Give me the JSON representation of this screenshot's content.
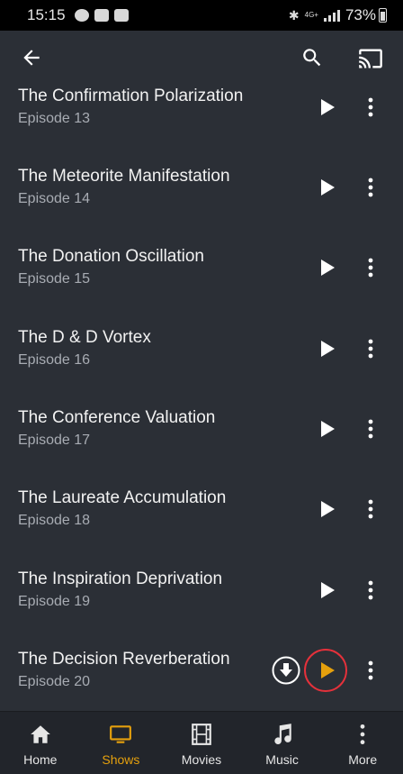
{
  "status_bar": {
    "time": "15:15",
    "network_label": "4G+",
    "battery_percent": "73%"
  },
  "app_bar": {
    "back_icon": "back-arrow-icon",
    "search_icon": "search-icon",
    "cast_icon": "cast-icon"
  },
  "episodes": [
    {
      "title": "The Confirmation Polarization",
      "subtitle": "Episode 13"
    },
    {
      "title": "The Meteorite Manifestation",
      "subtitle": "Episode 14"
    },
    {
      "title": "The Donation Oscillation",
      "subtitle": "Episode 15"
    },
    {
      "title": "The D & D Vortex",
      "subtitle": "Episode 16"
    },
    {
      "title": "The Conference Valuation",
      "subtitle": "Episode 17"
    },
    {
      "title": "The Laureate Accumulation",
      "subtitle": "Episode 18"
    },
    {
      "title": "The Inspiration Deprivation",
      "subtitle": "Episode 19"
    },
    {
      "title": "The Decision Reverberation",
      "subtitle": "Episode 20"
    }
  ],
  "bottom_nav": [
    {
      "label": "Home",
      "icon": "home-icon"
    },
    {
      "label": "Shows",
      "icon": "tv-icon",
      "active": true
    },
    {
      "label": "Movies",
      "icon": "film-icon"
    },
    {
      "label": "Music",
      "icon": "music-note-icon"
    },
    {
      "label": "More",
      "icon": "more-vertical-icon"
    }
  ],
  "colors": {
    "background": "#2b2f36",
    "accent": "#e5a00d",
    "highlight_ring": "#e5313b",
    "nav_background": "#22252b"
  }
}
